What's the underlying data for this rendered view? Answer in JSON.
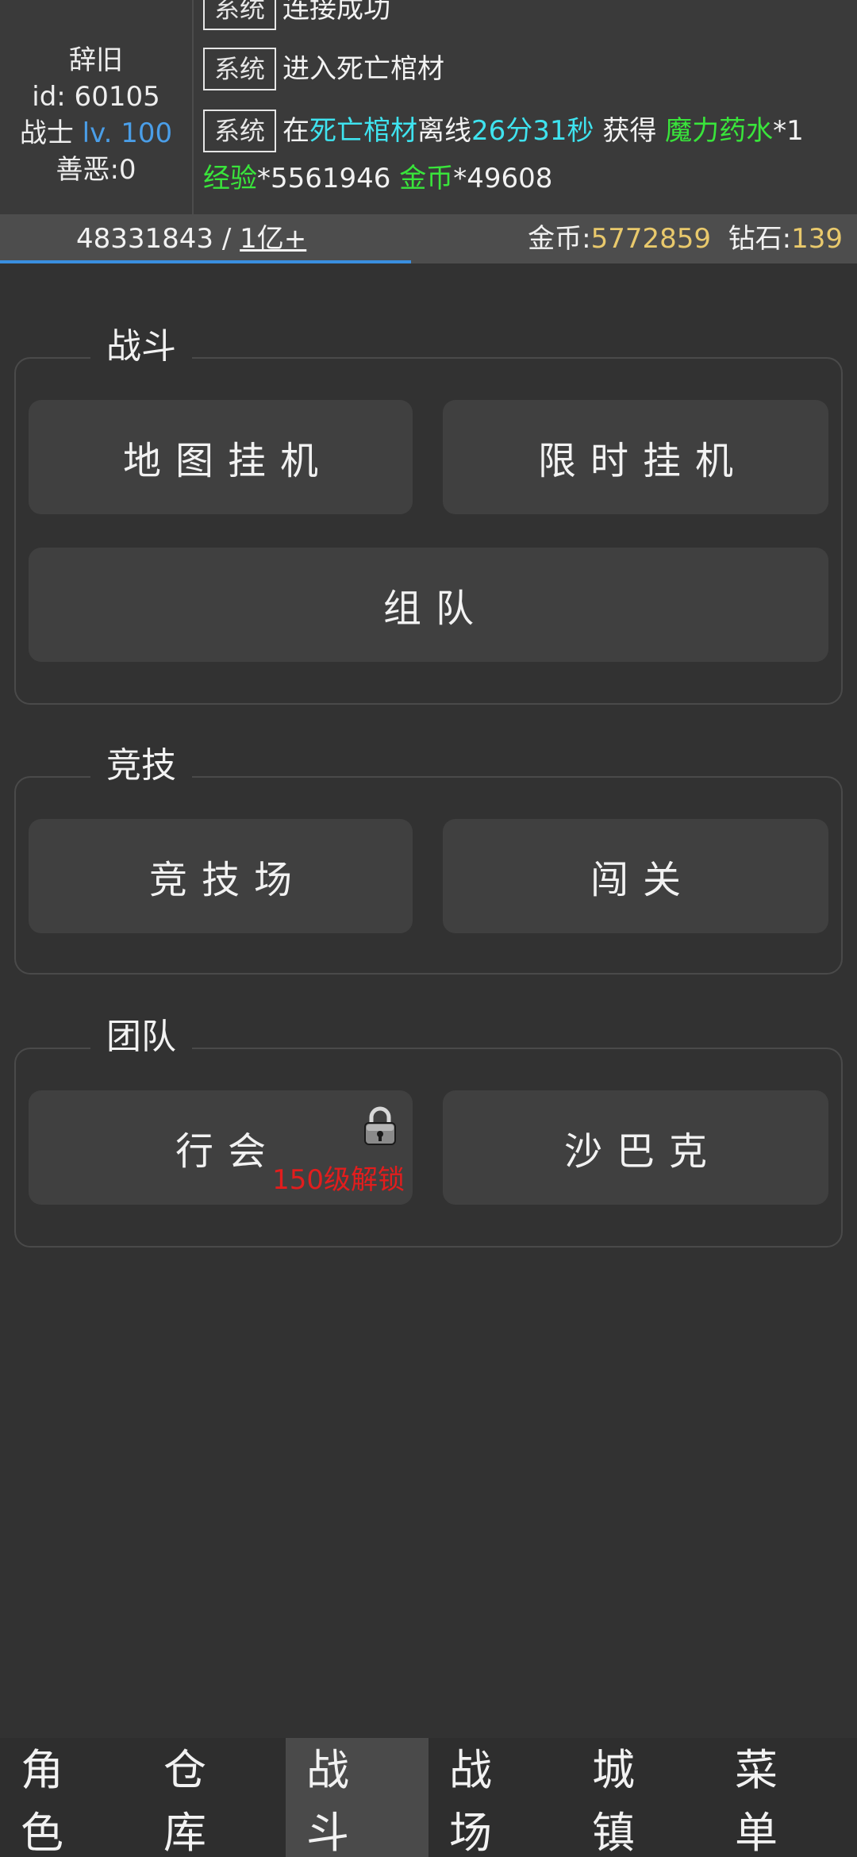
{
  "player": {
    "name": "辞旧",
    "id_text": "id: 60105",
    "class": "战士",
    "level": "lv. 100",
    "karma": "善恶:0"
  },
  "log": {
    "tag": "系统",
    "line1": "连接成功",
    "line2": "进入死亡棺材",
    "line3_pre": "在",
    "line3_map": "死亡棺材",
    "line3_mid": "离线",
    "line3_time": "26分31秒",
    "line3_get": " 获得 ",
    "line3_item": "魔力药水",
    "line3_qty": "*1",
    "line4_exp_label": "经验",
    "line4_exp_val": "*5561946 ",
    "line4_gold_label": "金币",
    "line4_gold_val": "*49608"
  },
  "exp": {
    "current": "48331843 / ",
    "max": "1亿+",
    "progress_fraction": 0.48
  },
  "currency": {
    "gold_label": "金币:",
    "gold_value": "5772859",
    "diamond_label": "  钻石:",
    "diamond_value": "139"
  },
  "sections": {
    "battle": {
      "title": "战斗",
      "map_idle": "地图挂机",
      "timed_idle": "限时挂机",
      "team": "组队"
    },
    "arena": {
      "title": "竞技",
      "arena": "竞技场",
      "challenge": "闯关"
    },
    "group": {
      "title": "团队",
      "guild": "行会",
      "guild_lock": "150级解锁",
      "sabak": "沙巴克"
    }
  },
  "nav": {
    "items": [
      "角色",
      "仓库",
      "战斗",
      "战场",
      "城镇",
      "菜单"
    ],
    "active_index": 2
  },
  "colors": {
    "accent_blue": "#3a8fe0",
    "gold": "#e9c96c",
    "cyan": "#3fe3ef",
    "green": "#39e53b",
    "lock_red": "#e21d1d"
  }
}
